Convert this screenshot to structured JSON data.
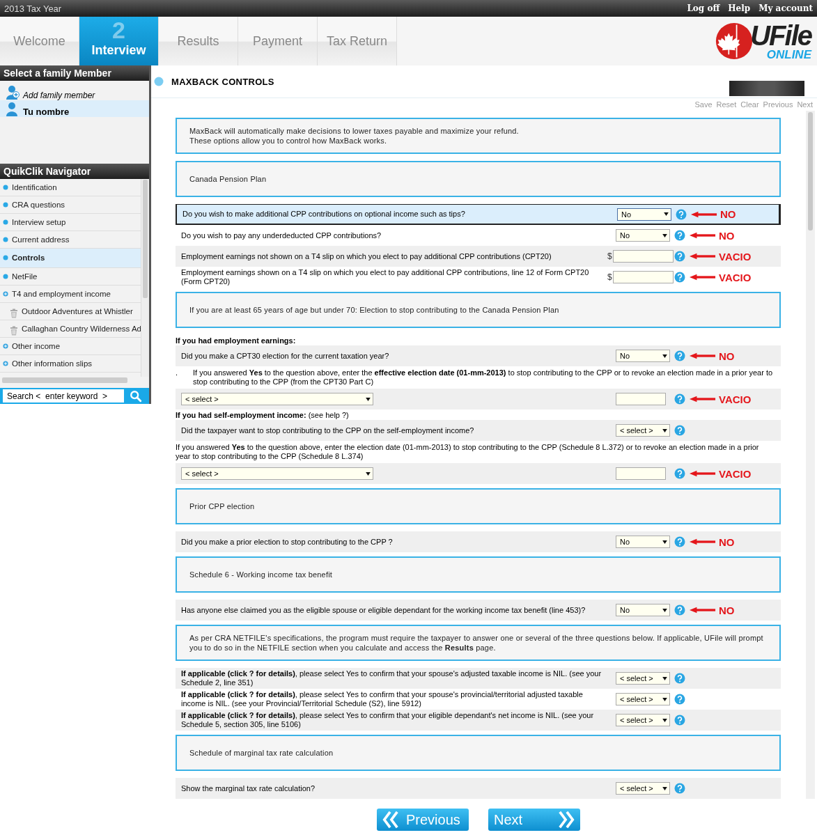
{
  "top_bar": {
    "title": "2013 Tax Year",
    "links": [
      "Log off",
      "Help",
      "My account"
    ]
  },
  "tabs": [
    {
      "label": "Welcome",
      "selected": false
    },
    {
      "label": "Interview",
      "selected": true,
      "step": "2"
    },
    {
      "label": "Results",
      "selected": false
    },
    {
      "label": "Payment",
      "selected": false
    },
    {
      "label": "Tax Return",
      "selected": false
    }
  ],
  "logo": {
    "name": "UFile",
    "tagline": "ONLINE"
  },
  "family": {
    "title": "Select a family Member",
    "members": [
      {
        "kind": "add",
        "name": "Add family member",
        "selected": false
      },
      {
        "kind": "person",
        "name": "Tu nombre",
        "selected": true
      }
    ]
  },
  "navigator": {
    "title": "QuikClik Navigator",
    "items": [
      {
        "kind": "page",
        "label": "Identification",
        "selected": false
      },
      {
        "kind": "page",
        "label": "CRA questions",
        "selected": false
      },
      {
        "kind": "page",
        "label": "Interview setup",
        "selected": false
      },
      {
        "kind": "page",
        "label": "Current address",
        "selected": false
      },
      {
        "kind": "page",
        "label": "Controls",
        "selected": true
      },
      {
        "kind": "page",
        "label": "NetFile",
        "selected": false
      },
      {
        "kind": "group",
        "label": "T4 and employment income",
        "selected": false,
        "children": [
          {
            "kind": "slip",
            "label": "Outdoor Adventures at Whistler",
            "selected": false
          },
          {
            "kind": "slip",
            "label": "Callaghan Country Wilderness Ad",
            "selected": false
          }
        ]
      },
      {
        "kind": "group",
        "label": "Other income",
        "selected": false
      },
      {
        "kind": "group",
        "label": "Other information slips",
        "selected": false
      }
    ]
  },
  "search": {
    "value": "Search <  enter keyword  >"
  },
  "page": {
    "title": "MAXBACK CONTROLS",
    "actions": [
      "Save",
      "Reset",
      "Clear",
      "Previous",
      "Next"
    ],
    "rows": [
      {
        "kind": "section",
        "text": "MaxBack will automatically make decisions to lower taxes payable and maximize your refund.\nThese options allow you to control how MaxBack works."
      },
      {
        "kind": "section",
        "text": "Canada Pension Plan"
      },
      {
        "kind": "select",
        "text": "Do you wish to make additional CPP contributions on optional income such as tips?",
        "value": "No",
        "focused": true,
        "annotation": "NO"
      },
      {
        "kind": "select",
        "text": "Do you wish to pay any underdeducted CPP contributions?",
        "value": "No",
        "focused": false,
        "annotation": "NO"
      },
      {
        "kind": "money",
        "text": "Employment earnings not shown on a T4 slip on which you elect to pay additional CPP contributions (CPT20)",
        "currency": "$",
        "focused": false,
        "annotation": "VACIO"
      },
      {
        "kind": "money",
        "text": "Employment earnings shown on a T4 slip on which you elect to pay additional CPP contributions, line 12 of Form CPT20 (Form CPT20)",
        "currency": "$",
        "focused": false,
        "annotation": "VACIO"
      },
      {
        "kind": "section",
        "text": "If you are at least 65 years of age but under 70: Election to stop contributing to the Canada Pension Plan"
      },
      {
        "kind": "heading",
        "text": "**If you had employment earnings:**"
      },
      {
        "kind": "select",
        "text": "Did you make a CPT30 election for the current taxation year?",
        "value": "No",
        "focused": false,
        "annotation": "NO"
      },
      {
        "kind": "note",
        "lead": ".",
        "text": "If you answered **Yes** to the question above, enter the **effective election date (01-mm-2013)** to stop contributing to the CPP or to revoke an election made in a prior year to stop contributing to the CPP (from the CPT30 Part C)"
      },
      {
        "kind": "wide",
        "value": "< select >",
        "annotation": "VACIO"
      },
      {
        "kind": "heading",
        "text": "**If you had self-employment income:** (see help ?)"
      },
      {
        "kind": "select",
        "text": "Did the taxpayer want to stop contributing to the CPP on the self-employment income?",
        "value": "< select >",
        "focused": false
      },
      {
        "kind": "note",
        "text": "If you answered **Yes** to the question above, enter the election date (01-mm-2013) to stop contributing to the CPP (Schedule 8 L.372) or to revoke an election made in a prior year to stop contributing to the CPP (Schedule 8 L.374)"
      },
      {
        "kind": "wide",
        "value": "< select >",
        "annotation": "VACIO"
      },
      {
        "kind": "section",
        "text": "Prior CPP election"
      },
      {
        "kind": "select",
        "text": "Did you make a prior election to stop contributing to the CPP ?",
        "value": "No",
        "focused": false,
        "annotation": "NO"
      },
      {
        "kind": "section",
        "text": "Schedule 6 - Working income tax benefit"
      },
      {
        "kind": "select",
        "text": "Has anyone else claimed you as the eligible spouse or eligible dependant for the working income tax benefit (line 453)?",
        "value": "No",
        "focused": false,
        "annotation": "NO"
      },
      {
        "kind": "section",
        "text": "As per CRA NETFILE's specifications, the program must require the taxpayer to answer one or several of the three questions below. If applicable, UFile will prompt you to do so in the NETFILE section when you calculate and access the **Results** page."
      },
      {
        "kind": "select",
        "text": "**If applicable (click ? for details)**, please select Yes to confirm that your spouse's adjusted taxable income is NIL. (see your Schedule 2, line 351)",
        "value": "< select >",
        "focused": false
      },
      {
        "kind": "select",
        "text": "**If applicable (click ? for details)**, please select Yes to confirm that your spouse's provincial/territorial adjusted taxable income is NIL. (see your Provincial/Territorial Schedule (S2), line 5912)",
        "value": "< select >",
        "focused": false
      },
      {
        "kind": "select",
        "text": "**If applicable (click ? for details)**, please select Yes to confirm that your eligible dependant's net income is NIL. (see your Schedule 5, section 305, line 5106)",
        "value": "< select >",
        "focused": false
      },
      {
        "kind": "section",
        "text": "Schedule of marginal tax rate calculation"
      },
      {
        "kind": "select",
        "text": "Show the marginal tax rate calculation?",
        "value": "< select >",
        "focused": false
      }
    ]
  },
  "buttons": [
    {
      "kind": "previous",
      "label": "Previous"
    },
    {
      "kind": "next",
      "label": "Next"
    }
  ]
}
